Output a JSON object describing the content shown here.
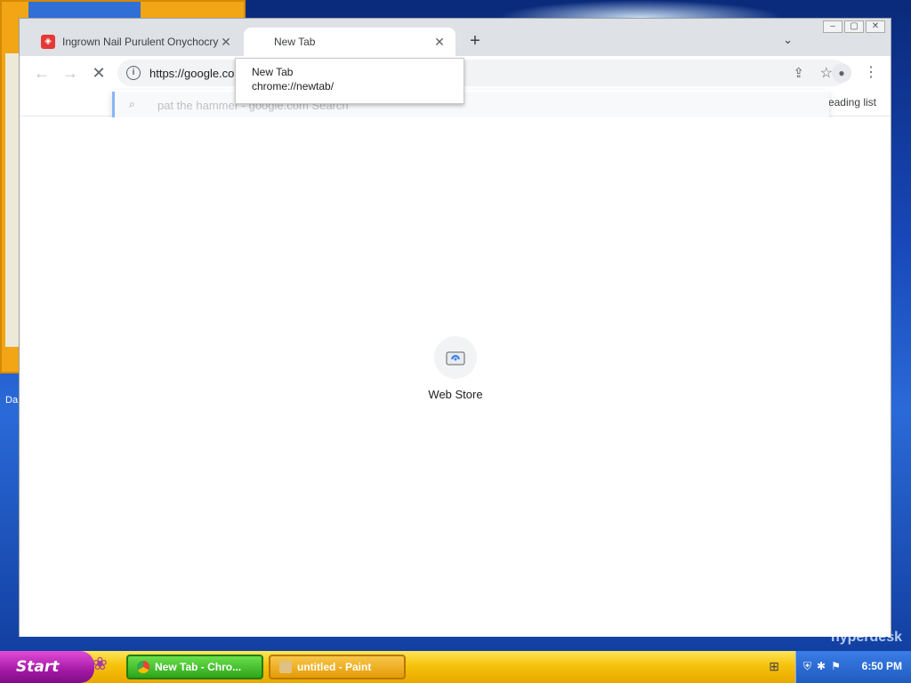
{
  "tabs": [
    {
      "title": "Ingrown Nail Purulent Onychocryptosis",
      "favicon": "red-brand-icon",
      "active": false
    },
    {
      "title": "New Tab",
      "favicon": "loading-blank",
      "active": true
    }
  ],
  "tab_search_icon": "chevron-down-icon",
  "toolbar": {
    "url": "https://google.co",
    "reading_list": "Reading list"
  },
  "omnibox_suggestion": {
    "text": "pat the hammer - google.com Search"
  },
  "tooltip": {
    "title": "New Tab",
    "url": "chrome://newtab/"
  },
  "shortcuts": [
    {
      "label": "Web Store",
      "icon": "web-store-icon"
    }
  ],
  "window_controls": [
    "minimize",
    "maximize",
    "close"
  ],
  "taskbar": {
    "start_label": "Start",
    "items": [
      {
        "label": "New Tab - Chro...",
        "active": true
      },
      {
        "label": "untitled - Paint",
        "active": false
      }
    ],
    "clock": "6:50 PM"
  },
  "desktop": {
    "left_label": "Da",
    "watermark": "hyperdesk"
  },
  "colors": {
    "taskbar": "#f6c20c",
    "start": "#a419a6",
    "tray": "#1f5cc0",
    "chrome_frame": "#dee1e6"
  }
}
